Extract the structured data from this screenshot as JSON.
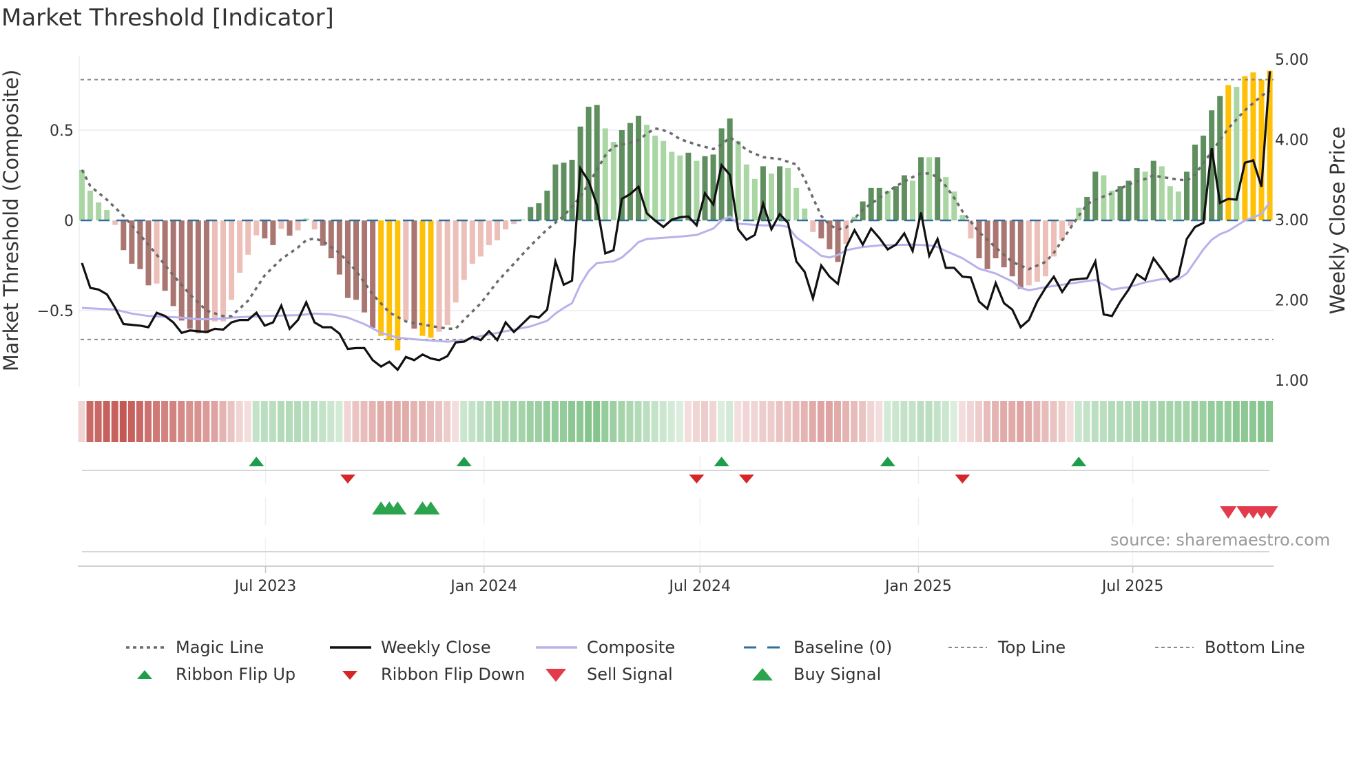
{
  "title": "Market Threshold [Indicator]",
  "source": "source: sharemaestro.com",
  "colors": {
    "bar_G": "#5f8f5f",
    "bar_g": "#a9d6a3",
    "bar_R": "#a97672",
    "bar_r": "#ecbfb9",
    "bar_Y": "#ffc107",
    "ribbon_red": "#c0504d",
    "ribbon_green": "#5cb066",
    "magic": "#6b6b6b",
    "close": "#111111",
    "composite": "#b8b2ea",
    "baseline": "#2f6f9f",
    "refline": "#8a8a8a",
    "flip_up": "#1e9e4a",
    "flip_down": "#d62728",
    "buy": "#2ca44e",
    "sell": "#e23b4c"
  },
  "chart_data": {
    "type": "bar+line",
    "title": "Market Threshold [Indicator]",
    "ylabel_left": "Market Threshold (Composite)",
    "ylabel_right": "Weekly Close Price",
    "x_unit": "week index",
    "ylim_left": [
      -0.9,
      0.92
    ],
    "ylim_right": [
      0.9,
      5.17
    ],
    "y_ticks_left": [
      {
        "v": 0.5,
        "label": "0.5"
      },
      {
        "v": 0,
        "label": "0"
      },
      {
        "v": -0.5,
        "label": "−0.5"
      }
    ],
    "y_ticks_right": [
      {
        "v": 5,
        "label": "5.00"
      },
      {
        "v": 4,
        "label": "4.00"
      },
      {
        "v": 3,
        "label": "3.00"
      },
      {
        "v": 2,
        "label": "2.00"
      },
      {
        "v": 1,
        "label": "1.00"
      }
    ],
    "x_ticks": [
      {
        "week": 22.1,
        "label": "Jul 2023"
      },
      {
        "week": 48.4,
        "label": "Jan 2024"
      },
      {
        "week": 74.4,
        "label": "Jul 2024"
      },
      {
        "week": 100.7,
        "label": "Jan 2025"
      },
      {
        "week": 126.5,
        "label": "Jul 2025"
      }
    ],
    "top_line": 0.78,
    "bottom_line": -0.66,
    "baseline": 0,
    "composite_bars": [
      0.28,
      0.165,
      0.1,
      0.057,
      -0.025,
      -0.165,
      -0.24,
      -0.27,
      -0.36,
      -0.35,
      -0.39,
      -0.475,
      -0.555,
      -0.6,
      -0.625,
      -0.625,
      -0.56,
      -0.56,
      -0.44,
      -0.29,
      -0.19,
      -0.083,
      -0.1,
      -0.137,
      -0.047,
      -0.085,
      -0.055,
      0.01,
      -0.05,
      -0.14,
      -0.21,
      -0.3,
      -0.43,
      -0.44,
      -0.51,
      -0.595,
      -0.64,
      -0.665,
      -0.72,
      -0.553,
      -0.6,
      -0.64,
      -0.65,
      -0.617,
      -0.58,
      -0.455,
      -0.33,
      -0.24,
      -0.2,
      -0.137,
      -0.11,
      -0.05,
      -0.02,
      0.006,
      0.074,
      0.095,
      0.165,
      0.31,
      0.32,
      0.336,
      0.52,
      0.63,
      0.64,
      0.51,
      0.435,
      0.5,
      0.54,
      0.58,
      0.53,
      0.47,
      0.44,
      0.38,
      0.36,
      0.375,
      0.33,
      0.356,
      0.365,
      0.51,
      0.565,
      0.44,
      0.31,
      0.23,
      0.3,
      0.26,
      0.3,
      0.29,
      0.18,
      0.066,
      -0.064,
      -0.1,
      -0.16,
      -0.23,
      -0.13,
      0.02,
      0.105,
      0.18,
      0.18,
      0.165,
      0.19,
      0.25,
      0.22,
      0.35,
      0.35,
      0.35,
      0.24,
      0.16,
      0.03,
      -0.1,
      -0.21,
      -0.27,
      -0.21,
      -0.26,
      -0.31,
      -0.38,
      -0.36,
      -0.34,
      -0.31,
      -0.2,
      -0.11,
      -0.03,
      0.07,
      0.13,
      0.27,
      0.25,
      0.165,
      0.19,
      0.22,
      0.29,
      0.27,
      0.33,
      0.3,
      0.19,
      0.16,
      0.27,
      0.42,
      0.47,
      0.61,
      0.69,
      0.75,
      0.74,
      0.8,
      0.82,
      0.78,
      0.83
    ],
    "bar_types": "ggggrRRRRrRRRRRRrrrrrrRRrRrgrRRRRRRRYYYrRYYrrrrrrrrrrgGGGGGGGGGggGGGgggggGgGGGGgggGgGgggrRRRrgGGGgGGgGgGgggrRRRRRRrrrrrrgGGggGGGgGgggGGGGGYgYYYY",
    "bar_type_legend": {
      "G": "strong positive",
      "g": "weak positive",
      "R": "strong negative",
      "r": "weak negative",
      "Y": "extreme"
    },
    "weekly_close": [
      2.46,
      2.15,
      2.13,
      2.07,
      1.9,
      1.7,
      1.69,
      1.68,
      1.66,
      1.84,
      1.8,
      1.72,
      1.59,
      1.62,
      1.61,
      1.6,
      1.64,
      1.63,
      1.72,
      1.75,
      1.75,
      1.84,
      1.68,
      1.72,
      1.93,
      1.64,
      1.75,
      1.97,
      1.72,
      1.66,
      1.66,
      1.58,
      1.39,
      1.4,
      1.4,
      1.25,
      1.17,
      1.23,
      1.13,
      1.29,
      1.25,
      1.32,
      1.27,
      1.25,
      1.3,
      1.47,
      1.48,
      1.54,
      1.5,
      1.61,
      1.5,
      1.72,
      1.6,
      1.7,
      1.8,
      1.78,
      1.88,
      2.48,
      2.19,
      2.24,
      3.64,
      3.48,
      3.18,
      2.58,
      2.62,
      3.26,
      3.32,
      3.41,
      3.08,
      2.99,
      2.91,
      3.0,
      3.03,
      3.04,
      2.93,
      3.33,
      3.19,
      3.68,
      3.56,
      2.88,
      2.75,
      2.81,
      3.2,
      2.88,
      3.07,
      2.96,
      2.48,
      2.35,
      2.02,
      2.43,
      2.29,
      2.2,
      2.66,
      2.87,
      2.69,
      2.89,
      2.77,
      2.63,
      2.69,
      2.83,
      2.61,
      3.09,
      2.55,
      2.76,
      2.4,
      2.4,
      2.29,
      2.28,
      1.98,
      1.89,
      2.21,
      1.96,
      1.88,
      1.66,
      1.75,
      1.98,
      2.15,
      2.29,
      2.1,
      2.25,
      2.26,
      2.27,
      2.48,
      1.82,
      1.8,
      1.98,
      2.13,
      2.32,
      2.25,
      2.52,
      2.38,
      2.23,
      2.3,
      2.76,
      2.91,
      2.96,
      3.89,
      3.21,
      3.26,
      3.25,
      3.71,
      3.74,
      3.41,
      4.85
    ],
    "magic_line": [
      [
        0,
        0.28
      ],
      [
        1,
        0.19
      ],
      [
        3,
        0.115
      ],
      [
        5,
        0.025
      ],
      [
        7,
        -0.08
      ],
      [
        9,
        -0.19
      ],
      [
        11,
        -0.305
      ],
      [
        13,
        -0.41
      ],
      [
        15,
        -0.5
      ],
      [
        17,
        -0.53
      ],
      [
        18,
        -0.53
      ],
      [
        20,
        -0.445
      ],
      [
        22,
        -0.305
      ],
      [
        24,
        -0.215
      ],
      [
        26,
        -0.15
      ],
      [
        27,
        -0.11
      ],
      [
        28,
        -0.1
      ],
      [
        29,
        -0.115
      ],
      [
        31,
        -0.18
      ],
      [
        33,
        -0.28
      ],
      [
        35,
        -0.41
      ],
      [
        37,
        -0.51
      ],
      [
        39,
        -0.56
      ],
      [
        42,
        -0.585
      ],
      [
        44,
        -0.6
      ],
      [
        45,
        -0.6
      ],
      [
        46,
        -0.55
      ],
      [
        48,
        -0.46
      ],
      [
        50,
        -0.34
      ],
      [
        52,
        -0.24
      ],
      [
        54,
        -0.14
      ],
      [
        56,
        -0.05
      ],
      [
        58,
        0.025
      ],
      [
        60,
        0.13
      ],
      [
        62,
        0.28
      ],
      [
        63,
        0.36
      ],
      [
        64,
        0.41
      ],
      [
        66,
        0.43
      ],
      [
        67,
        0.445
      ],
      [
        68,
        0.48
      ],
      [
        69,
        0.51
      ],
      [
        70,
        0.5
      ],
      [
        71,
        0.48
      ],
      [
        72,
        0.45
      ],
      [
        74,
        0.42
      ],
      [
        76,
        0.395
      ],
      [
        77,
        0.42
      ],
      [
        78,
        0.46
      ],
      [
        79,
        0.43
      ],
      [
        80,
        0.39
      ],
      [
        81,
        0.37
      ],
      [
        82,
        0.35
      ],
      [
        84,
        0.34
      ],
      [
        86,
        0.31
      ],
      [
        87,
        0.23
      ],
      [
        88,
        0.125
      ],
      [
        89,
        0.025
      ],
      [
        90,
        -0.025
      ],
      [
        91,
        -0.05
      ],
      [
        92,
        -0.04
      ],
      [
        93,
        0.01
      ],
      [
        94,
        0.06
      ],
      [
        96,
        0.125
      ],
      [
        98,
        0.19
      ],
      [
        100,
        0.24
      ],
      [
        101,
        0.26
      ],
      [
        102,
        0.26
      ],
      [
        103,
        0.24
      ],
      [
        104,
        0.19
      ],
      [
        105,
        0.125
      ],
      [
        106,
        0.05
      ],
      [
        108,
        -0.065
      ],
      [
        110,
        -0.15
      ],
      [
        112,
        -0.23
      ],
      [
        114,
        -0.27
      ],
      [
        116,
        -0.23
      ],
      [
        117,
        -0.18
      ],
      [
        118,
        -0.11
      ],
      [
        120,
        0.025
      ],
      [
        121,
        0.09
      ],
      [
        122,
        0.115
      ],
      [
        124,
        0.15
      ],
      [
        126,
        0.2
      ],
      [
        128,
        0.23
      ],
      [
        129,
        0.25
      ],
      [
        130,
        0.24
      ],
      [
        133,
        0.22
      ],
      [
        134,
        0.255
      ],
      [
        136,
        0.38
      ],
      [
        138,
        0.51
      ],
      [
        140,
        0.61
      ],
      [
        142,
        0.69
      ],
      [
        143,
        0.72
      ]
    ],
    "composite_line": [
      [
        0,
        1.9
      ],
      [
        4,
        1.88
      ],
      [
        6,
        1.83
      ],
      [
        8,
        1.8
      ],
      [
        12,
        1.78
      ],
      [
        14,
        1.76
      ],
      [
        16,
        1.76
      ],
      [
        18,
        1.78
      ],
      [
        22,
        1.8
      ],
      [
        26,
        1.81
      ],
      [
        28,
        1.83
      ],
      [
        30,
        1.82
      ],
      [
        32,
        1.78
      ],
      [
        34,
        1.7
      ],
      [
        36,
        1.59
      ],
      [
        38,
        1.53
      ],
      [
        40,
        1.51
      ],
      [
        44,
        1.48
      ],
      [
        46,
        1.5
      ],
      [
        48,
        1.55
      ],
      [
        50,
        1.59
      ],
      [
        52,
        1.63
      ],
      [
        54,
        1.67
      ],
      [
        56,
        1.74
      ],
      [
        57,
        1.83
      ],
      [
        58,
        1.9
      ],
      [
        59,
        1.96
      ],
      [
        60,
        2.19
      ],
      [
        61,
        2.36
      ],
      [
        62,
        2.46
      ],
      [
        64,
        2.48
      ],
      [
        65,
        2.53
      ],
      [
        66,
        2.62
      ],
      [
        67,
        2.72
      ],
      [
        68,
        2.76
      ],
      [
        72,
        2.79
      ],
      [
        74,
        2.81
      ],
      [
        75,
        2.85
      ],
      [
        76,
        2.89
      ],
      [
        77,
        2.99
      ],
      [
        78,
        3.04
      ],
      [
        79,
        2.95
      ],
      [
        82,
        2.93
      ],
      [
        84,
        2.93
      ],
      [
        85,
        2.91
      ],
      [
        86,
        2.78
      ],
      [
        88,
        2.63
      ],
      [
        89,
        2.55
      ],
      [
        90,
        2.53
      ],
      [
        91,
        2.56
      ],
      [
        92,
        2.62
      ],
      [
        94,
        2.66
      ],
      [
        96,
        2.68
      ],
      [
        100,
        2.69
      ],
      [
        102,
        2.68
      ],
      [
        103,
        2.66
      ],
      [
        104,
        2.61
      ],
      [
        106,
        2.52
      ],
      [
        108,
        2.39
      ],
      [
        110,
        2.33
      ],
      [
        112,
        2.23
      ],
      [
        113,
        2.15
      ],
      [
        114,
        2.12
      ],
      [
        116,
        2.16
      ],
      [
        118,
        2.19
      ],
      [
        120,
        2.22
      ],
      [
        122,
        2.25
      ],
      [
        123,
        2.19
      ],
      [
        124,
        2.13
      ],
      [
        126,
        2.16
      ],
      [
        128,
        2.22
      ],
      [
        130,
        2.26
      ],
      [
        132,
        2.26
      ],
      [
        133,
        2.33
      ],
      [
        134,
        2.48
      ],
      [
        135,
        2.63
      ],
      [
        136,
        2.75
      ],
      [
        137,
        2.82
      ],
      [
        138,
        2.86
      ],
      [
        140,
        2.99
      ],
      [
        142,
        3.07
      ],
      [
        143,
        3.22
      ]
    ],
    "ribbon": [
      -0.2,
      -0.85,
      -0.85,
      -0.9,
      -0.9,
      -0.95,
      -0.9,
      -0.85,
      -0.8,
      -0.75,
      -0.7,
      -0.7,
      -0.65,
      -0.6,
      -0.6,
      -0.55,
      -0.5,
      -0.4,
      -0.3,
      -0.2,
      -0.15,
      0.3,
      0.35,
      0.35,
      0.4,
      0.4,
      0.4,
      0.35,
      0.35,
      0.3,
      0.25,
      0.2,
      -0.2,
      -0.3,
      -0.35,
      -0.4,
      -0.45,
      -0.45,
      -0.45,
      -0.45,
      -0.4,
      -0.4,
      -0.35,
      -0.3,
      -0.25,
      -0.15,
      0.25,
      0.3,
      0.35,
      0.4,
      0.45,
      0.45,
      0.5,
      0.5,
      0.55,
      0.55,
      0.6,
      0.6,
      0.6,
      0.65,
      0.65,
      0.7,
      0.7,
      0.6,
      0.55,
      0.5,
      0.45,
      0.4,
      0.35,
      0.3,
      0.25,
      0.2,
      0.15,
      -0.15,
      -0.2,
      -0.25,
      -0.2,
      0.15,
      0.2,
      -0.15,
      -0.2,
      -0.2,
      -0.25,
      -0.25,
      -0.3,
      -0.3,
      -0.35,
      -0.4,
      -0.45,
      -0.5,
      -0.5,
      -0.45,
      -0.4,
      -0.35,
      -0.3,
      -0.2,
      -0.15,
      0.2,
      0.25,
      0.3,
      0.3,
      0.35,
      0.35,
      0.3,
      0.25,
      0.15,
      -0.15,
      -0.2,
      -0.25,
      -0.35,
      -0.4,
      -0.45,
      -0.45,
      -0.5,
      -0.45,
      -0.4,
      -0.35,
      -0.3,
      -0.25,
      -0.15,
      0.25,
      0.3,
      0.35,
      0.35,
      0.4,
      0.4,
      0.4,
      0.45,
      0.45,
      0.45,
      0.5,
      0.5,
      0.5,
      0.5,
      0.55,
      0.55,
      0.6,
      0.6,
      0.6,
      0.65,
      0.65,
      0.65,
      0.7,
      0.7
    ],
    "ribbon_flip_up": [
      21,
      46,
      77,
      97,
      120
    ],
    "ribbon_flip_down": [
      32,
      74,
      80,
      106
    ],
    "buy_signals": [
      36,
      37,
      38,
      41,
      42
    ],
    "sell_signals": [
      138,
      140,
      141,
      142,
      143
    ],
    "legend": [
      {
        "key": "magic",
        "label": "Magic Line"
      },
      {
        "key": "close",
        "label": "Weekly Close"
      },
      {
        "key": "composite",
        "label": "Composite"
      },
      {
        "key": "baseline",
        "label": "Baseline (0)"
      },
      {
        "key": "top",
        "label": "Top Line"
      },
      {
        "key": "bottom",
        "label": "Bottom Line"
      },
      {
        "key": "flip_up",
        "label": "Ribbon Flip Up"
      },
      {
        "key": "flip_down",
        "label": "Ribbon Flip Down"
      },
      {
        "key": "sell",
        "label": "Sell Signal"
      },
      {
        "key": "buy",
        "label": "Buy Signal"
      }
    ],
    "legend_placement": "bottom"
  }
}
